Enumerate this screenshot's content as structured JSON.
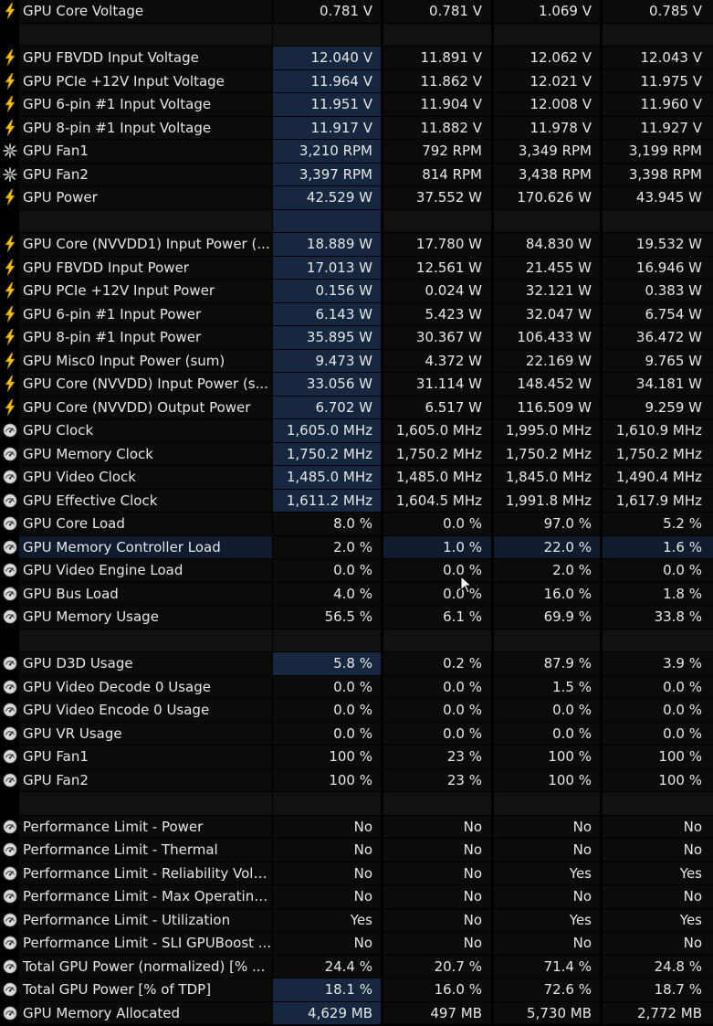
{
  "colors": {
    "background": "#000000",
    "cell": "#0b0b0b",
    "selected_column": "#172740",
    "text": "#e6e6e6",
    "bolt_icon": "#f5c000",
    "gauge_icon": "#d8d8d8"
  },
  "rows": [
    {
      "icon": "bolt",
      "name": "GPU Core Voltage",
      "v": [
        "0.781 V",
        "0.781 V",
        "1.069 V",
        "0.785 V"
      ],
      "hl": ""
    },
    {
      "icon": "",
      "name": "",
      "v": [
        "",
        "",
        "",
        ""
      ],
      "hl": "blank"
    },
    {
      "icon": "bolt",
      "name": "GPU FBVDD Input Voltage",
      "v": [
        "12.040 V",
        "11.891 V",
        "12.062 V",
        "12.043 V"
      ],
      "hl": "v1"
    },
    {
      "icon": "bolt",
      "name": "GPU PCIe +12V Input Voltage",
      "v": [
        "11.964 V",
        "11.862 V",
        "12.021 V",
        "11.975 V"
      ],
      "hl": "v1"
    },
    {
      "icon": "bolt",
      "name": "GPU 6-pin #1 Input Voltage",
      "v": [
        "11.951 V",
        "11.904 V",
        "12.008 V",
        "11.960 V"
      ],
      "hl": "v1"
    },
    {
      "icon": "bolt",
      "name": "GPU 8-pin #1 Input Voltage",
      "v": [
        "11.917 V",
        "11.882 V",
        "11.978 V",
        "11.927 V"
      ],
      "hl": "v1"
    },
    {
      "icon": "fan",
      "name": "GPU Fan1",
      "v": [
        "3,210 RPM",
        "792 RPM",
        "3,349 RPM",
        "3,199 RPM"
      ],
      "hl": "v1"
    },
    {
      "icon": "fan",
      "name": "GPU Fan2",
      "v": [
        "3,397 RPM",
        "814 RPM",
        "3,438 RPM",
        "3,398 RPM"
      ],
      "hl": "v1"
    },
    {
      "icon": "bolt",
      "name": "GPU Power",
      "v": [
        "42.529 W",
        "37.552 W",
        "170.626 W",
        "43.945 W"
      ],
      "hl": "v1"
    },
    {
      "icon": "",
      "name": "",
      "v": [
        "",
        "",
        "",
        ""
      ],
      "hl": "blank-v1"
    },
    {
      "icon": "bolt",
      "name": "GPU Core (NVVDD1) Input Power (...",
      "v": [
        "18.889 W",
        "17.780 W",
        "84.830 W",
        "19.532 W"
      ],
      "hl": "v1"
    },
    {
      "icon": "bolt",
      "name": "GPU FBVDD Input Power",
      "v": [
        "17.013 W",
        "12.561 W",
        "21.455 W",
        "16.946 W"
      ],
      "hl": "v1"
    },
    {
      "icon": "bolt",
      "name": "GPU PCIe +12V Input Power",
      "v": [
        "0.156 W",
        "0.024 W",
        "32.121 W",
        "0.383 W"
      ],
      "hl": "v1"
    },
    {
      "icon": "bolt",
      "name": "GPU 6-pin #1 Input Power",
      "v": [
        "6.143 W",
        "5.423 W",
        "32.047 W",
        "6.754 W"
      ],
      "hl": "v1"
    },
    {
      "icon": "bolt",
      "name": "GPU 8-pin #1 Input Power",
      "v": [
        "35.895 W",
        "30.367 W",
        "106.433 W",
        "36.472 W"
      ],
      "hl": "v1"
    },
    {
      "icon": "bolt",
      "name": "GPU Misc0 Input Power (sum)",
      "v": [
        "9.473 W",
        "4.372 W",
        "22.169 W",
        "9.765 W"
      ],
      "hl": "v1"
    },
    {
      "icon": "bolt",
      "name": "GPU Core (NVVDD) Input Power (s...",
      "v": [
        "33.056 W",
        "31.114 W",
        "148.452 W",
        "34.181 W"
      ],
      "hl": "v1"
    },
    {
      "icon": "bolt",
      "name": "GPU Core (NVVDD) Output Power",
      "v": [
        "6.702 W",
        "6.517 W",
        "116.509 W",
        "9.259 W"
      ],
      "hl": "v1"
    },
    {
      "icon": "gauge",
      "name": "GPU Clock",
      "v": [
        "1,605.0 MHz",
        "1,605.0 MHz",
        "1,995.0 MHz",
        "1,610.9 MHz"
      ],
      "hl": "v1"
    },
    {
      "icon": "gauge",
      "name": "GPU Memory Clock",
      "v": [
        "1,750.2 MHz",
        "1,750.2 MHz",
        "1,750.2 MHz",
        "1,750.2 MHz"
      ],
      "hl": "v1"
    },
    {
      "icon": "gauge",
      "name": "GPU Video Clock",
      "v": [
        "1,485.0 MHz",
        "1,485.0 MHz",
        "1,845.0 MHz",
        "1,490.4 MHz"
      ],
      "hl": "v1"
    },
    {
      "icon": "gauge",
      "name": "GPU Effective Clock",
      "v": [
        "1,611.2 MHz",
        "1,604.5 MHz",
        "1,991.8 MHz",
        "1,617.9 MHz"
      ],
      "hl": "v1"
    },
    {
      "icon": "gauge",
      "name": "GPU Core Load",
      "v": [
        "8.0 %",
        "0.0 %",
        "97.0 %",
        "5.2 %"
      ],
      "hl": ""
    },
    {
      "icon": "gauge",
      "name": "GPU Memory Controller Load",
      "v": [
        "2.0 %",
        "1.0 %",
        "22.0 %",
        "1.6 %"
      ],
      "hl": "all"
    },
    {
      "icon": "gauge",
      "name": "GPU Video Engine Load",
      "v": [
        "0.0 %",
        "0.0 %",
        "2.0 %",
        "0.0 %"
      ],
      "hl": ""
    },
    {
      "icon": "gauge",
      "name": "GPU Bus Load",
      "v": [
        "4.0 %",
        "0.0 %",
        "16.0 %",
        "1.8 %"
      ],
      "hl": ""
    },
    {
      "icon": "gauge",
      "name": "GPU Memory Usage",
      "v": [
        "56.5 %",
        "6.1 %",
        "69.9 %",
        "33.8 %"
      ],
      "hl": ""
    },
    {
      "icon": "",
      "name": "",
      "v": [
        "",
        "",
        "",
        ""
      ],
      "hl": "blank"
    },
    {
      "icon": "gauge",
      "name": "GPU D3D Usage",
      "v": [
        "5.8 %",
        "0.2 %",
        "87.9 %",
        "3.9 %"
      ],
      "hl": "v1"
    },
    {
      "icon": "gauge",
      "name": "GPU Video Decode 0 Usage",
      "v": [
        "0.0 %",
        "0.0 %",
        "1.5 %",
        "0.0 %"
      ],
      "hl": ""
    },
    {
      "icon": "gauge",
      "name": "GPU Video Encode 0 Usage",
      "v": [
        "0.0 %",
        "0.0 %",
        "0.0 %",
        "0.0 %"
      ],
      "hl": ""
    },
    {
      "icon": "gauge",
      "name": "GPU VR Usage",
      "v": [
        "0.0 %",
        "0.0 %",
        "0.0 %",
        "0.0 %"
      ],
      "hl": ""
    },
    {
      "icon": "gauge",
      "name": "GPU Fan1",
      "v": [
        "100 %",
        "23 %",
        "100 %",
        "100 %"
      ],
      "hl": ""
    },
    {
      "icon": "gauge",
      "name": "GPU Fan2",
      "v": [
        "100 %",
        "23 %",
        "100 %",
        "100 %"
      ],
      "hl": ""
    },
    {
      "icon": "",
      "name": "",
      "v": [
        "",
        "",
        "",
        ""
      ],
      "hl": "blank"
    },
    {
      "icon": "gauge",
      "name": "Performance Limit - Power",
      "v": [
        "No",
        "No",
        "No",
        "No"
      ],
      "hl": ""
    },
    {
      "icon": "gauge",
      "name": "Performance Limit - Thermal",
      "v": [
        "No",
        "No",
        "No",
        "No"
      ],
      "hl": ""
    },
    {
      "icon": "gauge",
      "name": "Performance Limit - Reliability Voltage",
      "v": [
        "No",
        "No",
        "Yes",
        "Yes"
      ],
      "hl": ""
    },
    {
      "icon": "gauge",
      "name": "Performance Limit - Max Operating...",
      "v": [
        "No",
        "No",
        "No",
        "No"
      ],
      "hl": ""
    },
    {
      "icon": "gauge",
      "name": "Performance Limit - Utilization",
      "v": [
        "Yes",
        "No",
        "Yes",
        "Yes"
      ],
      "hl": ""
    },
    {
      "icon": "gauge",
      "name": "Performance Limit - SLI GPUBoost ...",
      "v": [
        "No",
        "No",
        "No",
        "No"
      ],
      "hl": ""
    },
    {
      "icon": "gauge",
      "name": "Total GPU Power (normalized) [% ...",
      "v": [
        "24.4 %",
        "20.7 %",
        "71.4 %",
        "24.8 %"
      ],
      "hl": ""
    },
    {
      "icon": "gauge",
      "name": "Total GPU Power [% of TDP]",
      "v": [
        "18.1 %",
        "16.0 %",
        "72.6 %",
        "18.7 %"
      ],
      "hl": "v1"
    },
    {
      "icon": "gauge",
      "name": "GPU Memory Allocated",
      "v": [
        "4,629 MB",
        "497 MB",
        "5,730 MB",
        "2,772 MB"
      ],
      "hl": "v1"
    }
  ]
}
